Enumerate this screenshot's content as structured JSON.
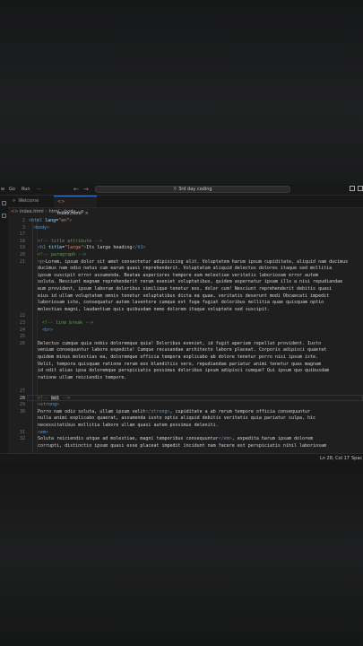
{
  "titlebar": {
    "menus": [
      "w",
      "Go",
      "Run",
      "···"
    ],
    "nav_back": "←",
    "nav_forward": "→",
    "search_icon": "search-icon",
    "command_center": "3rd day coding"
  },
  "tabs": [
    {
      "label": "Welcome",
      "icon": "vscode-icon",
      "active": false
    },
    {
      "label": "index.html",
      "icon": "html5-icon",
      "active": true,
      "close": "×"
    }
  ],
  "breadcrumb": [
    "index.html",
    "html",
    "body",
    "p"
  ],
  "lines": [
    {
      "num": "2",
      "indent": 0,
      "parts": [
        [
          "ang",
          "<"
        ],
        [
          "tag",
          "html"
        ],
        [
          "txt",
          " "
        ],
        [
          "attr",
          "lang"
        ],
        [
          "txt",
          "="
        ],
        [
          "str",
          "\"en\""
        ],
        [
          "ang",
          ">"
        ]
      ]
    },
    {
      "num": "3",
      "indent": 1,
      "parts": [
        [
          "ang",
          "<"
        ],
        [
          "tag",
          "body"
        ],
        [
          "ang",
          ">"
        ]
      ]
    },
    {
      "num": "17",
      "indent": 2,
      "parts": []
    },
    {
      "num": "18",
      "indent": 2,
      "parts": [
        [
          "com",
          "<!-- title attribute -->"
        ]
      ]
    },
    {
      "num": "19",
      "indent": 2,
      "parts": [
        [
          "ang",
          "<"
        ],
        [
          "tag",
          "h1"
        ],
        [
          "txt",
          " "
        ],
        [
          "attr",
          "title"
        ],
        [
          "txt",
          "="
        ],
        [
          "str",
          "\"large\""
        ],
        [
          "ang",
          ">"
        ],
        [
          "txt",
          "Its large heading"
        ],
        [
          "ang",
          "</"
        ],
        [
          "tag",
          "h1"
        ],
        [
          "ang",
          ">"
        ]
      ]
    },
    {
      "num": "20",
      "indent": 2,
      "parts": [
        [
          "com",
          "<!-- paragraph -->"
        ]
      ]
    },
    {
      "num": "21",
      "indent": 2,
      "parts": [
        [
          "ang",
          "<"
        ],
        [
          "tag",
          "p"
        ],
        [
          "ang",
          ">"
        ],
        [
          "txt",
          "Lorem, ipsum dolor sit amet consectetur adipisicing elit. Voluptatem harum ipsum cupiditate, aliquid nam ducimus"
        ]
      ]
    },
    {
      "num": "",
      "indent": 2,
      "parts": [
        [
          "txt",
          "ducimus nam odio natus cum earum quasi reprehenderit. Voluptatum aliquid delectus dolores itaque sed mollitia"
        ]
      ]
    },
    {
      "num": "",
      "indent": 2,
      "parts": [
        [
          "txt",
          "ipsum suscipit error assumenda. Beatae asperiores tempore eum molestiae veritatis laboriosam error autem"
        ]
      ]
    },
    {
      "num": "",
      "indent": 2,
      "parts": [
        [
          "txt",
          "soluta. Nesciunt magnam reprehenderit rerum eveniet voluptatibus, quidem aspernatur ipsam illo a nisi repudiandae"
        ]
      ]
    },
    {
      "num": "",
      "indent": 2,
      "parts": [
        [
          "txt",
          "eum provident, ipsum laborum doloribus similique tenetur eos, dolor cum! Nesciunt reprehenderit debitis quasi"
        ]
      ]
    },
    {
      "num": "",
      "indent": 2,
      "parts": [
        [
          "txt",
          "eius id ullam voluptatem omnis tenetur voluptatibus dicta ea quae, veritatis deserunt modi Obcaecati impedit"
        ]
      ]
    },
    {
      "num": "",
      "indent": 2,
      "parts": [
        [
          "txt",
          "laboriosam iste, consequatur autem laventore cumque est fuga fugiat doloribus mollitia quae quisquam optio"
        ]
      ]
    },
    {
      "num": "",
      "indent": 2,
      "parts": [
        [
          "txt",
          "molestias magni, laudantium quis quibusdam nemo dolorem itaque voluptate sed suscipit."
        ]
      ]
    },
    {
      "num": "22",
      "indent": 2,
      "parts": []
    },
    {
      "num": "23",
      "indent": 3,
      "parts": [
        [
          "com",
          "<!-- line break -->"
        ]
      ]
    },
    {
      "num": "24",
      "indent": 3,
      "parts": [
        [
          "ang",
          "<"
        ],
        [
          "tag",
          "br"
        ],
        [
          "ang",
          ">"
        ]
      ]
    },
    {
      "num": "25",
      "indent": 2,
      "parts": []
    },
    {
      "num": "26",
      "indent": 2,
      "parts": [
        [
          "txt",
          "Delectus cumque quia nobis doloremque quia! Doloribus eveniet, id fugit aperiam repellat provident. Iusto"
        ]
      ]
    },
    {
      "num": "",
      "indent": 2,
      "parts": [
        [
          "txt",
          "veniam consequuntur labore expedita! Cumque recusandae architecto labore placeat. Corporis adipisci quaerat"
        ]
      ]
    },
    {
      "num": "",
      "indent": 2,
      "parts": [
        [
          "txt",
          "quidem minus molestias ea, doloremque officia tempora explicabo ab dolore tenetur porro nisi ipsum iste."
        ]
      ]
    },
    {
      "num": "",
      "indent": 2,
      "parts": [
        [
          "txt",
          "Velit, tempora quisquam ratione rerum eos blanditiis vero, repudiandae pariatur animi tenetur quas magnam"
        ]
      ]
    },
    {
      "num": "",
      "indent": 2,
      "parts": [
        [
          "txt",
          "id odit alias ipsa doloremque perspiciatis possimus doloribus ipsum adipisci cumque? Qui ipsum quo quibusdam"
        ]
      ]
    },
    {
      "num": "",
      "indent": 2,
      "parts": [
        [
          "txt",
          "ratione ullam reiciendis tempore."
        ]
      ]
    },
    {
      "num": "",
      "indent": 2,
      "parts": []
    },
    {
      "num": "27",
      "indent": 2,
      "parts": []
    },
    {
      "num": "28",
      "indent": 2,
      "cur": true,
      "parts": [
        [
          "com",
          "<!-- "
        ],
        [
          "sel",
          "bol"
        ],
        [
          "com",
          " -->"
        ]
      ]
    },
    {
      "num": "29",
      "indent": 2,
      "parts": [
        [
          "ang",
          "<"
        ],
        [
          "tag",
          "strong"
        ],
        [
          "ang",
          ">"
        ]
      ]
    },
    {
      "num": "30",
      "indent": 2,
      "parts": [
        [
          "txt",
          "Porro nam odio soluta, ullam ipsum velit"
        ],
        [
          "ang",
          "</"
        ],
        [
          "tag",
          "strong"
        ],
        [
          "ang",
          ">"
        ],
        [
          "txt",
          ", cupiditate a ab rerum tempore officia consequuntur"
        ]
      ]
    },
    {
      "num": "",
      "indent": 2,
      "parts": [
        [
          "txt",
          "nulla animi explicabo quaerat, assumenda iusto optio aliquid debitis veritatis quia pariatur culpa, hic"
        ]
      ]
    },
    {
      "num": "",
      "indent": 2,
      "parts": [
        [
          "txt",
          "necessitatibus mollitia labore ullam quasi autem possimus deleniti."
        ]
      ]
    },
    {
      "num": "31",
      "indent": 2,
      "parts": [
        [
          "ang",
          "<"
        ],
        [
          "tag",
          "em"
        ],
        [
          "ang",
          ">"
        ]
      ]
    },
    {
      "num": "32",
      "indent": 2,
      "parts": [
        [
          "txt",
          "Soluta reiciendis atque ad molestiae, magni temporibus consequuntur"
        ],
        [
          "ang",
          "</"
        ],
        [
          "tag",
          "em"
        ],
        [
          "ang",
          ">"
        ],
        [
          "txt",
          ", expedita harum ipsam dolorem"
        ]
      ]
    },
    {
      "num": "",
      "indent": 2,
      "parts": [
        [
          "txt",
          "corrupti, distinctio ipsum quasi esse placeat impedit incidunt nam facere est perspiciatis nihil laboriosam"
        ]
      ]
    }
  ],
  "statusbar": {
    "position": "Ln 28, Col 17",
    "spaces": "Spac"
  },
  "colors": {
    "editor_bg": "#1f1f1f",
    "comment": "#6a9955",
    "tag": "#569cd6",
    "attribute": "#9cdcfe",
    "string": "#ce9178",
    "accent": "#3c7bd6"
  }
}
